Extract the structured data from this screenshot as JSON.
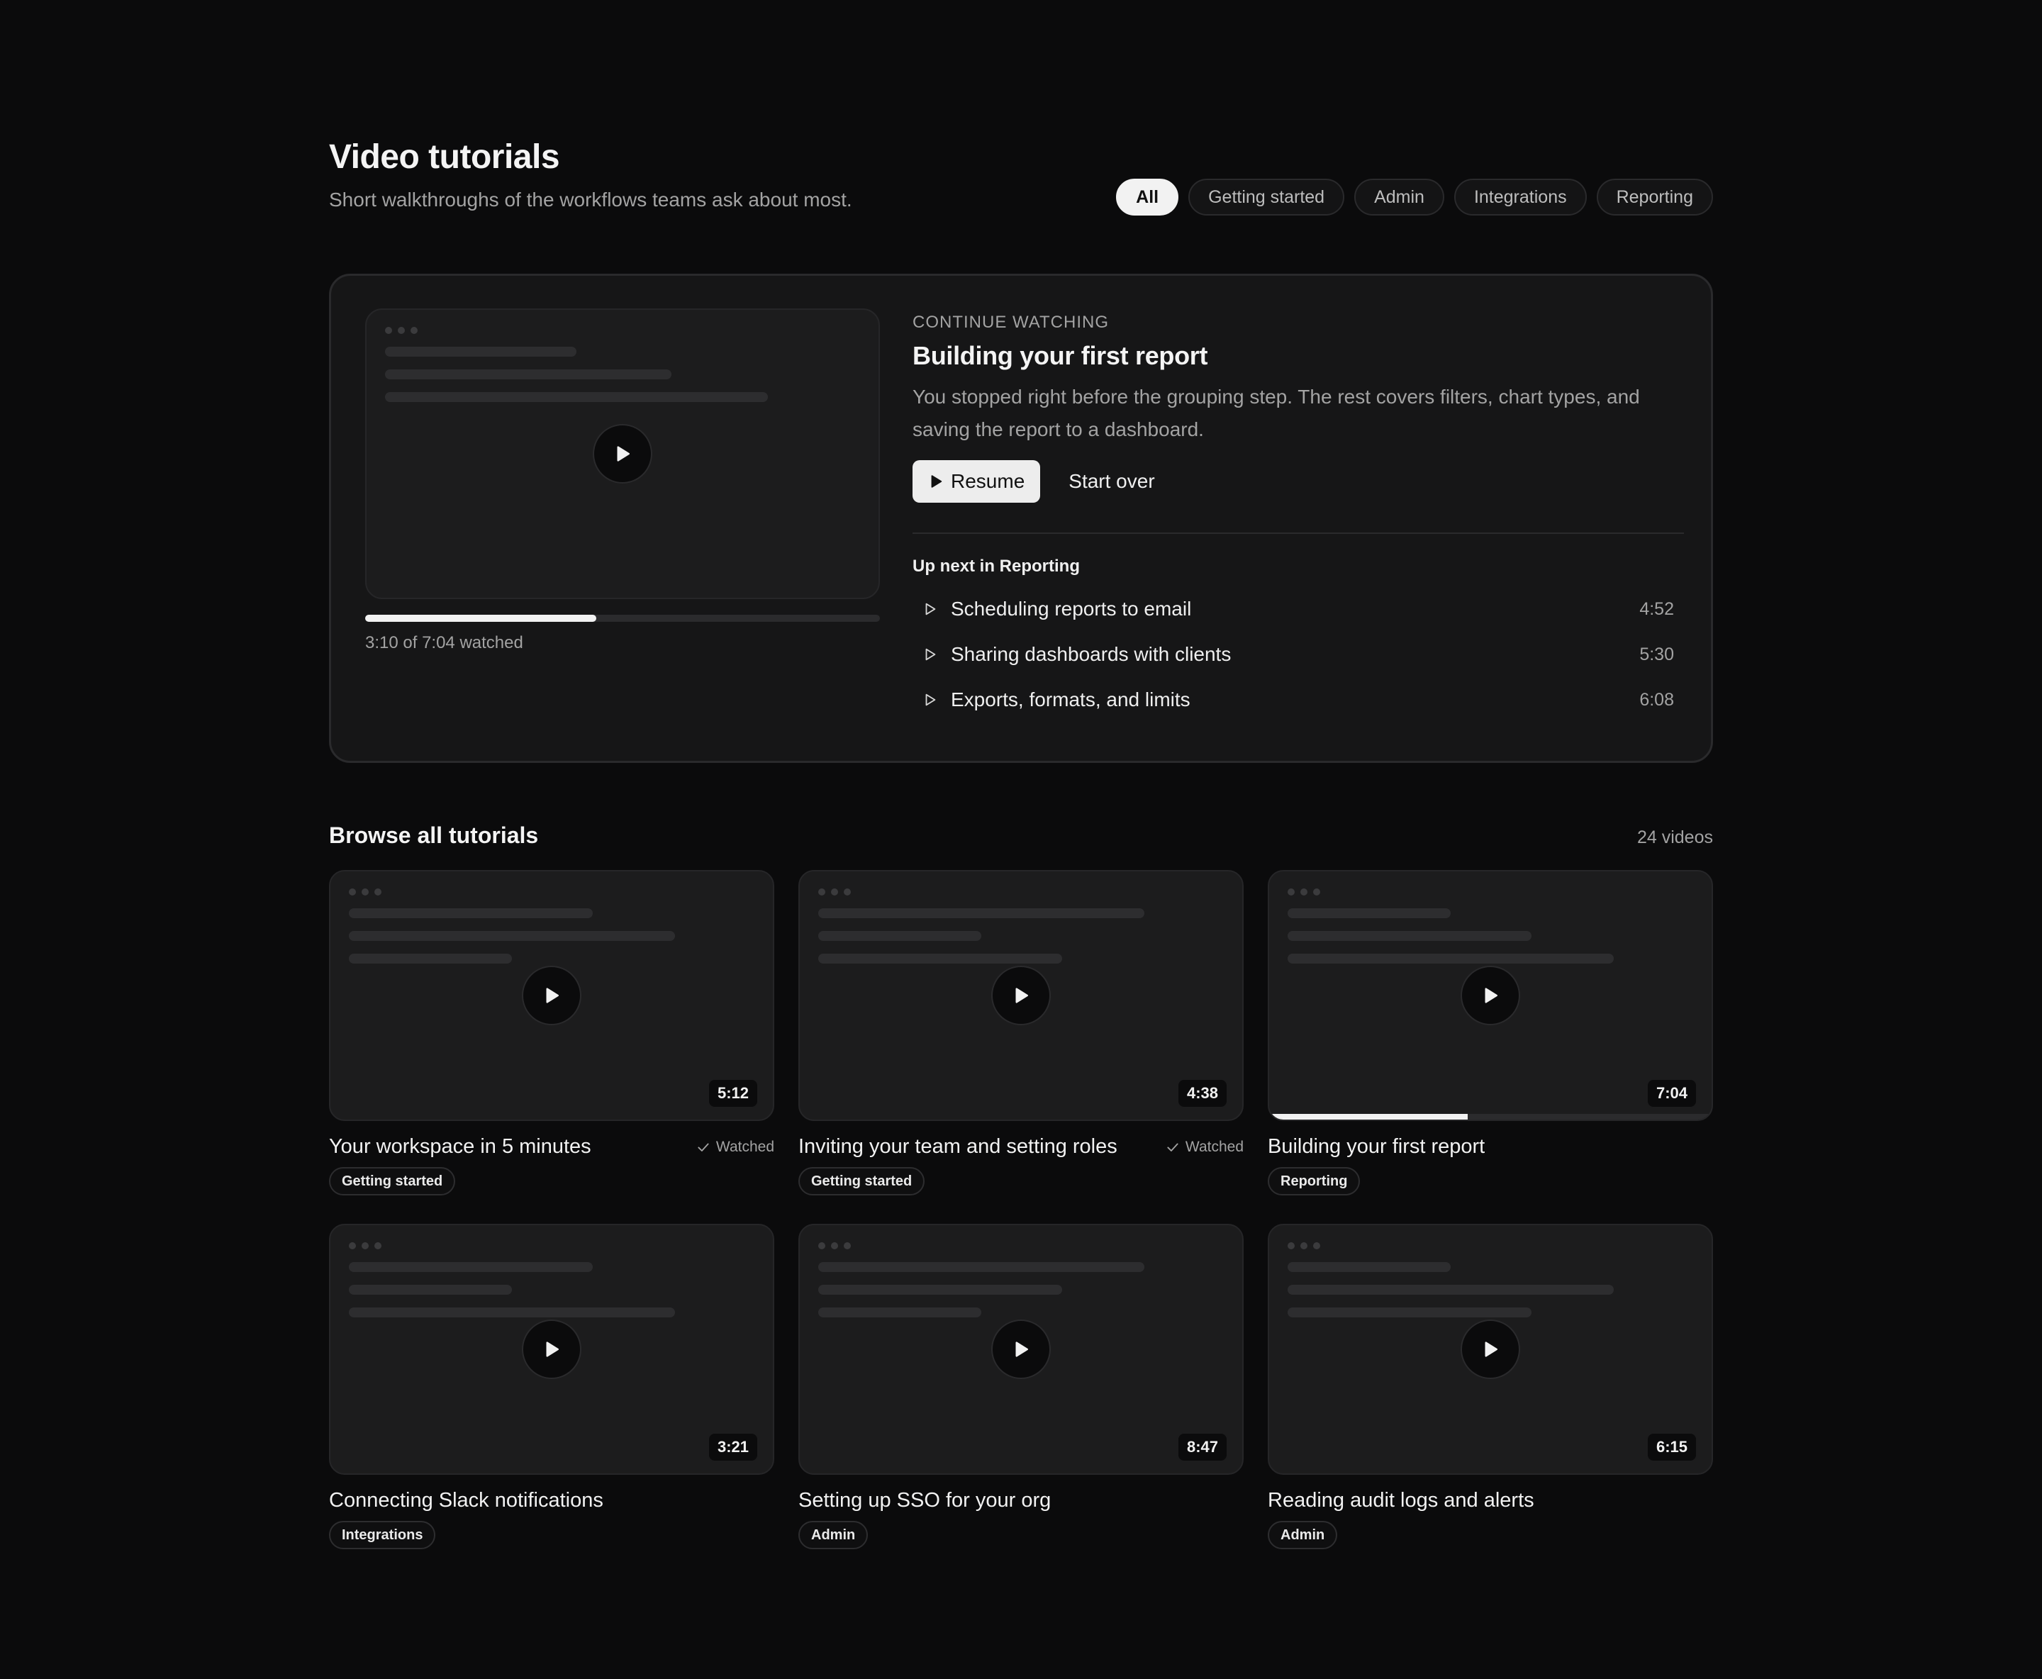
{
  "header": {
    "title": "Video tutorials",
    "subtitle": "Short walkthroughs of the workflows teams ask about most."
  },
  "filters": [
    "All",
    "Getting started",
    "Admin",
    "Integrations",
    "Reporting"
  ],
  "active_filter": "All",
  "continue": {
    "eyebrow": "CONTINUE WATCHING",
    "title": "Building your first report",
    "description": "You stopped right before the grouping step. The rest covers filters, chart types, and saving the report to a dashboard.",
    "resume_label": "Resume",
    "start_over_label": "Start over",
    "progress_fraction": 0.449,
    "watched_text": "3:10 of 7:04 watched",
    "up_next_label": "Up next in Reporting",
    "up_next": [
      {
        "title": "Scheduling reports to email",
        "duration": "4:52"
      },
      {
        "title": "Sharing dashboards with clients",
        "duration": "5:30"
      },
      {
        "title": "Exports, formats, and limits",
        "duration": "6:08"
      }
    ]
  },
  "browse": {
    "title": "Browse all tutorials",
    "count": "24 videos",
    "videos": [
      {
        "title": "Your workspace in 5 minutes",
        "duration": "5:12",
        "tag": "Getting started",
        "watched_label": "Watched",
        "progress_fraction": null
      },
      {
        "title": "Inviting your team and setting roles",
        "duration": "4:38",
        "tag": "Getting started",
        "watched_label": "Watched",
        "progress_fraction": null
      },
      {
        "title": "Building your first report",
        "duration": "7:04",
        "tag": "Reporting",
        "watched_label": "",
        "progress_fraction": 0.449
      },
      {
        "title": "Connecting Slack notifications",
        "duration": "3:21",
        "tag": "Integrations",
        "watched_label": "",
        "progress_fraction": null
      },
      {
        "title": "Setting up SSO for your org",
        "duration": "8:47",
        "tag": "Admin",
        "watched_label": "",
        "progress_fraction": null
      },
      {
        "title": "Reading audit logs and alerts",
        "duration": "6:15",
        "tag": "Admin",
        "watched_label": "",
        "progress_fraction": null
      }
    ]
  },
  "colors": {
    "background": "#0b0b0c",
    "card": "#161617",
    "accent": "#f2f2f2",
    "muted_text": "#a3a3a3"
  }
}
